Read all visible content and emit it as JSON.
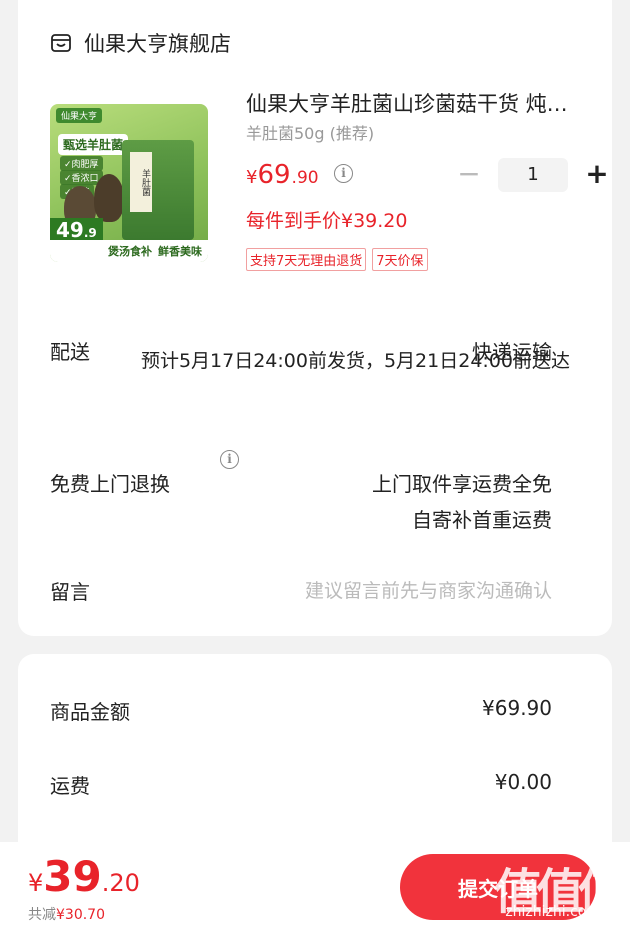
{
  "store": {
    "name": "仙果大亨旗舰店",
    "icon": "store-icon"
  },
  "product": {
    "title": "仙果大亨羊肚菌山珍菌菇干货 炖…",
    "spec": "羊肚菌50g (推荐)",
    "price_currency": "¥",
    "price_int": "69",
    "price_dec": ".90",
    "quantity": "1",
    "final_price": "每件到手价¥39.20",
    "tags": [
      "支持7天无理由退货",
      "7天价保"
    ],
    "image": {
      "brand_badge": "仙果大亨",
      "headline": "甄选羊肚菌",
      "bullets": [
        "✓肉肥厚",
        "✓香浓口",
        "✓无硫"
      ],
      "bag_label": "羊肚菌",
      "price_tag_int": "49",
      "price_tag_dec": ".9",
      "footer_left": "煲汤食补",
      "footer_right": "鲜香美味"
    }
  },
  "delivery": {
    "label": "配送",
    "method": "快递运输",
    "eta": "预计5月17日24:00前发货，5月21日24:00前送达"
  },
  "returns": {
    "label": "免费上门退换",
    "line1": "上门取件享运费全免",
    "line2": "自寄补首重运费"
  },
  "remark": {
    "label": "留言",
    "placeholder": "建议留言前先与商家沟通确认"
  },
  "summary": {
    "goods_label": "商品金额",
    "goods_value": "¥69.90",
    "shipping_label": "运费",
    "shipping_value": "¥0.00"
  },
  "checkout": {
    "currency": "¥",
    "total_int": "39",
    "total_dec": ".20",
    "saved_label": "共减",
    "saved_amount": "¥30.70",
    "submit_label": "提交订单"
  },
  "watermark": {
    "main": "值值值",
    "sub": "zhizhizhi.com"
  },
  "colors": {
    "accent": "#e8232a",
    "button": "#f1333c",
    "background": "#f2f2f2"
  }
}
